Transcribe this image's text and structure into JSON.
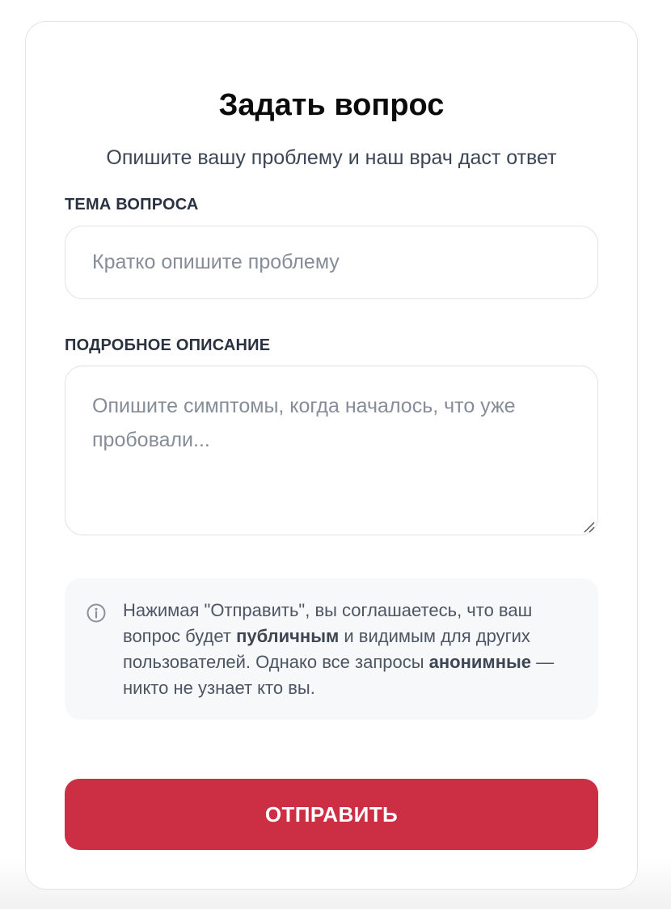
{
  "form": {
    "title": "Задать вопрос",
    "subtitle": "Опишите вашу проблему и наш врач даст ответ",
    "topic_label": "ТЕМА ВОПРОСА",
    "topic_placeholder": "Кратко опишите проблему",
    "topic_value": "",
    "description_label": "ПОДРОБНОЕ ОПИСАНИЕ",
    "description_placeholder": "Опишите симптомы, когда началось, что уже пробовали...",
    "description_value": ""
  },
  "notice": {
    "icon": "info-icon",
    "part1": "Нажимая \"Отправить\", вы соглашаетесь, что ваш вопрос будет ",
    "bold1": "публичным",
    "part2": " и видимым для других пользователей. Однако все запросы ",
    "bold2": "анонимные",
    "part3": " — никто не узнает кто вы."
  },
  "submit": {
    "label": "ОТПРАВИТЬ",
    "color": "#cc2f43"
  }
}
